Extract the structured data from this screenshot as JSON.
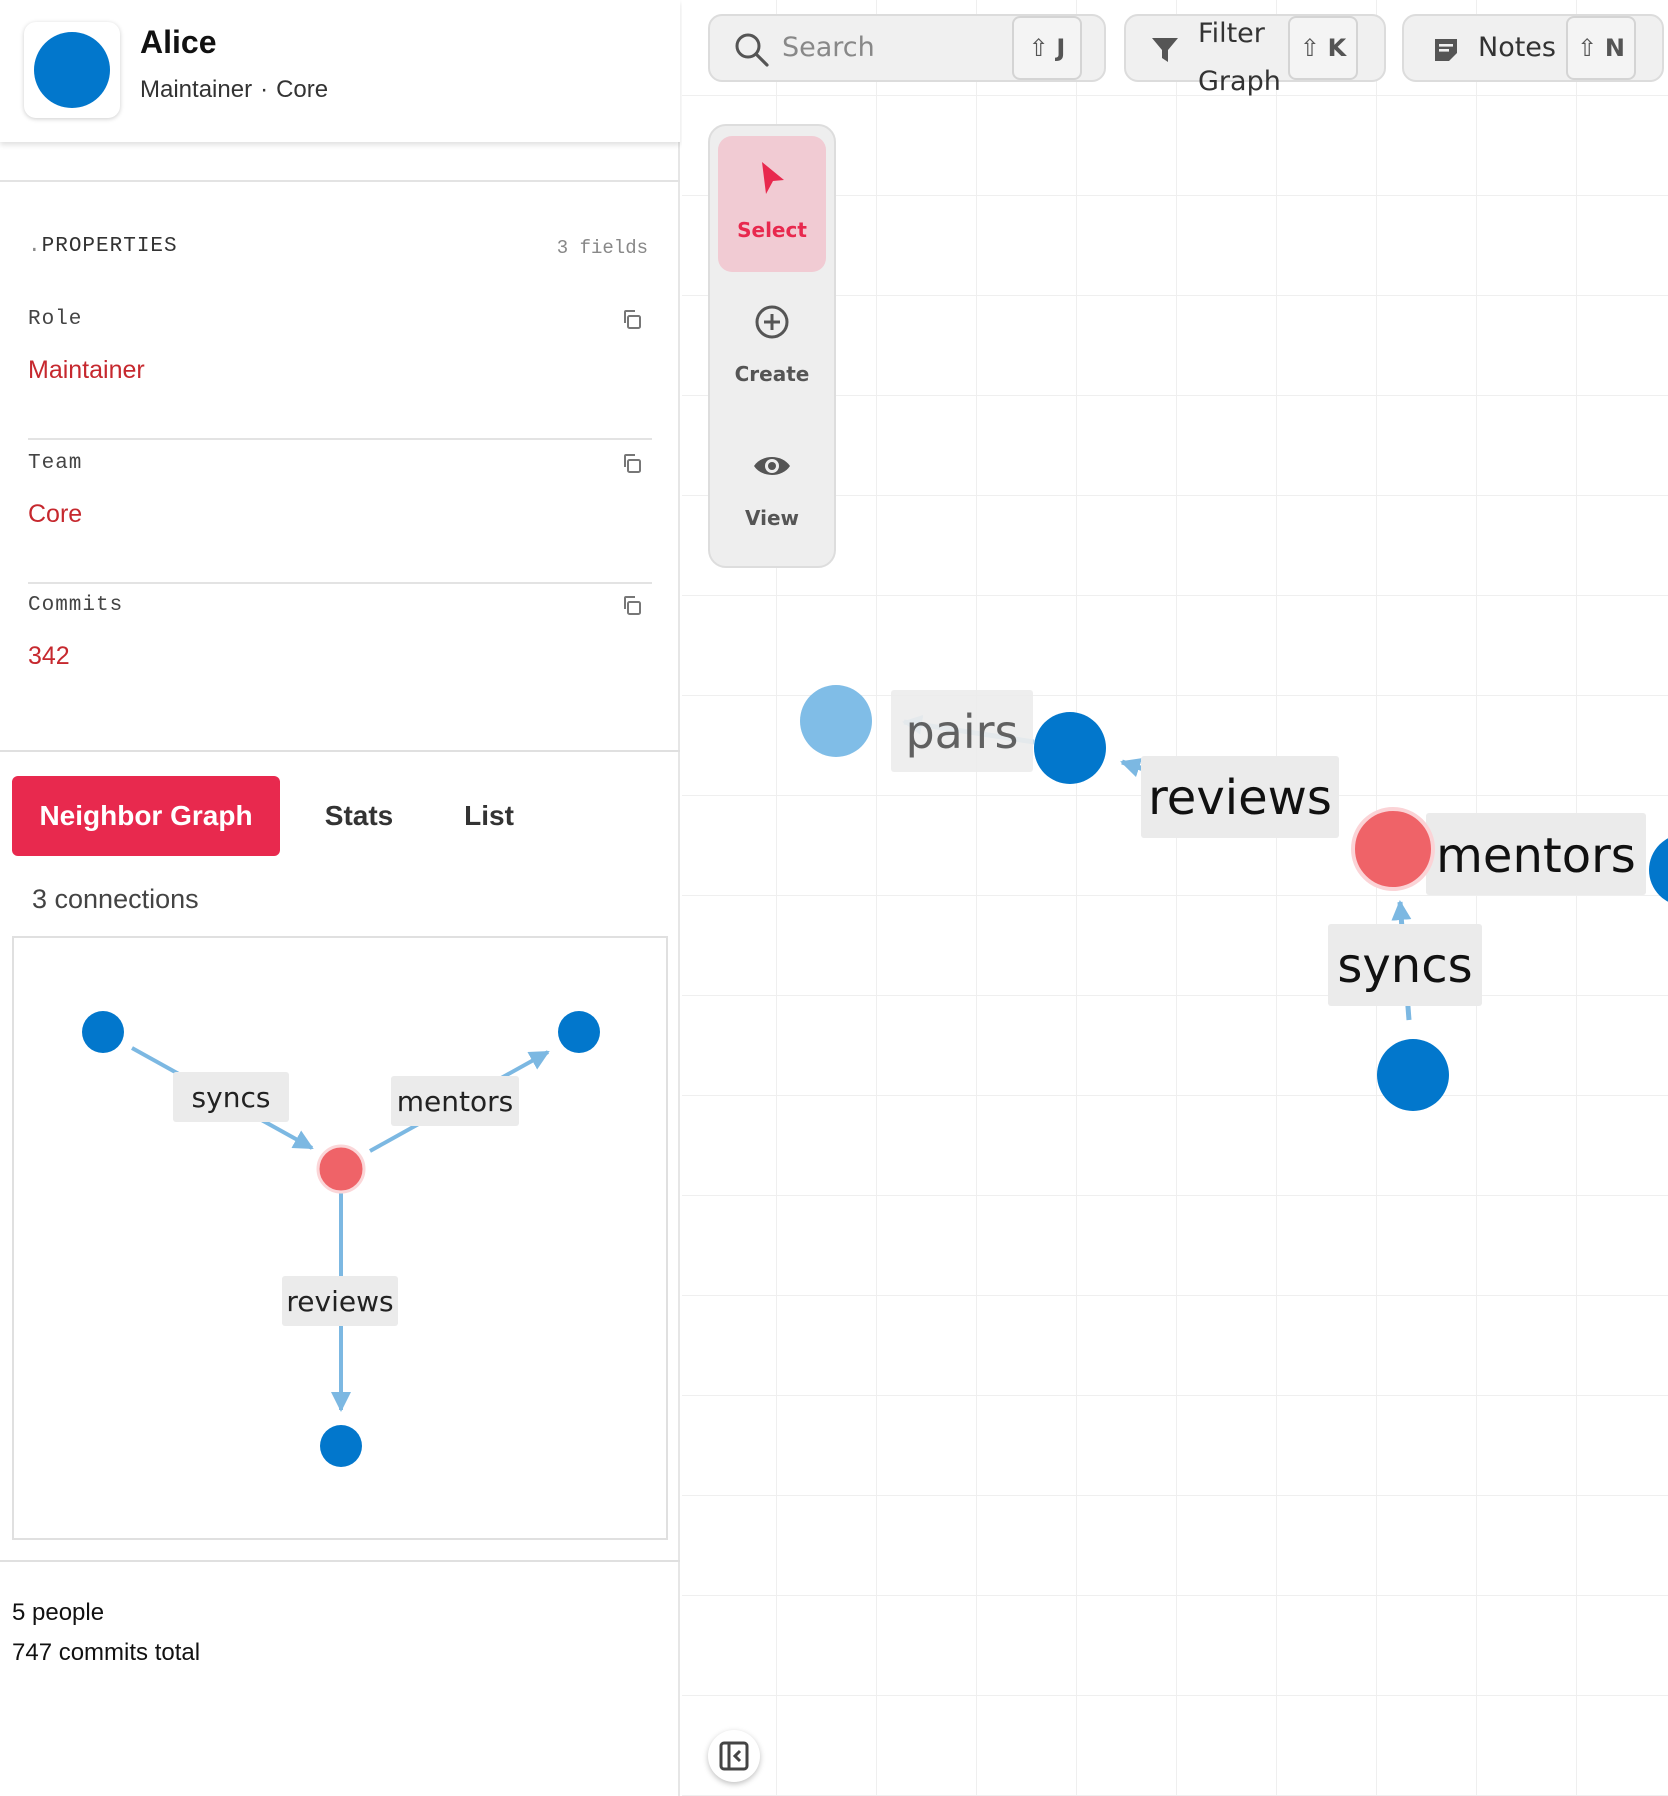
{
  "profile": {
    "name": "Alice",
    "role": "Maintainer",
    "separator": "·",
    "team": "Core",
    "avatar_color": "#0277cc"
  },
  "properties": {
    "title_prefix": ".",
    "title": "PROPERTIES",
    "count_label": "3 fields",
    "fields": [
      {
        "key": "Role",
        "value": "Maintainer"
      },
      {
        "key": "Team",
        "value": "Core"
      },
      {
        "key": "Commits",
        "value": "342"
      }
    ]
  },
  "tabs": [
    {
      "label": "Neighbor Graph",
      "active": true
    },
    {
      "label": "Stats",
      "active": false
    },
    {
      "label": "List",
      "active": false
    }
  ],
  "neighbor_graph": {
    "connections_label": "3 connections",
    "center_color": "#ef6368",
    "node_color": "#0277cc",
    "edge_color": "#7cb8e2",
    "edges": [
      {
        "label": "syncs",
        "direction": "in"
      },
      {
        "label": "mentors",
        "direction": "out"
      },
      {
        "label": "reviews",
        "direction": "out"
      }
    ]
  },
  "summary": {
    "people": "5 people",
    "commits": "747 commits total"
  },
  "toolbar": {
    "search": {
      "placeholder": "Search",
      "shortcut_mod": "⇧",
      "shortcut_key": "J"
    },
    "filter": {
      "label_line1": "Filter",
      "label_line2": "Graph",
      "shortcut_mod": "⇧",
      "shortcut_key": "K"
    },
    "notes": {
      "label": "Notes",
      "shortcut_mod": "⇧",
      "shortcut_key": "N"
    }
  },
  "tools": [
    {
      "label": "Select",
      "icon": "pointer-icon",
      "active": true
    },
    {
      "label": "Create",
      "icon": "plus-circle-icon",
      "active": false
    },
    {
      "label": "View",
      "icon": "eye-icon",
      "active": false
    }
  ],
  "main_graph": {
    "accent": "#e8294e",
    "edges": [
      {
        "label": "pairs"
      },
      {
        "label": "reviews"
      },
      {
        "label": "mentors"
      },
      {
        "label": "syncs"
      }
    ]
  }
}
